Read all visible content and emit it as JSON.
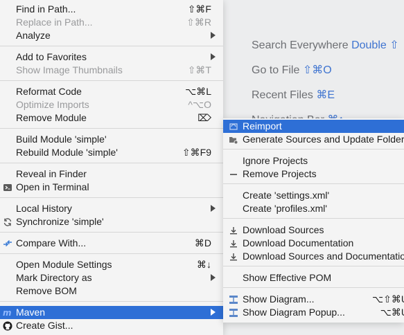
{
  "background_hints": [
    {
      "text": "Search Everywhere",
      "shortcut": "Double ⇧"
    },
    {
      "text": "Go to File",
      "shortcut": "⇧⌘O"
    },
    {
      "text": "Recent Files",
      "shortcut": "⌘E"
    },
    {
      "text": "Navigation Bar",
      "shortcut": "⌘↑"
    }
  ],
  "context_menu": {
    "find_in_path": {
      "label": "Find in Path...",
      "shortcut": "⇧⌘F"
    },
    "replace_in_path": {
      "label": "Replace in Path...",
      "shortcut": "⇧⌘R"
    },
    "analyze": {
      "label": "Analyze"
    },
    "add_to_favorites": {
      "label": "Add to Favorites"
    },
    "show_image_thumbnails": {
      "label": "Show Image Thumbnails",
      "shortcut": "⇧⌘T"
    },
    "reformat_code": {
      "label": "Reformat Code",
      "shortcut": "⌥⌘L"
    },
    "optimize_imports": {
      "label": "Optimize Imports",
      "shortcut": "^⌥O"
    },
    "remove_module": {
      "label": "Remove Module",
      "shortcut": "⌦"
    },
    "build_module": {
      "label": "Build Module 'simple'"
    },
    "rebuild_module": {
      "label": "Rebuild Module 'simple'",
      "shortcut": "⇧⌘F9"
    },
    "reveal_in_finder": {
      "label": "Reveal in Finder"
    },
    "open_in_terminal": {
      "label": "Open in Terminal"
    },
    "local_history": {
      "label": "Local History"
    },
    "synchronize": {
      "label": "Synchronize 'simple'"
    },
    "compare_with": {
      "label": "Compare With...",
      "shortcut": "⌘D"
    },
    "open_module_settings": {
      "label": "Open Module Settings",
      "shortcut": "⌘↓"
    },
    "mark_directory_as": {
      "label": "Mark Directory as"
    },
    "remove_bom": {
      "label": "Remove BOM"
    },
    "maven": {
      "label": "Maven"
    },
    "create_gist": {
      "label": "Create Gist..."
    }
  },
  "maven_submenu": {
    "reimport": {
      "label": "Reimport"
    },
    "generate_sources": {
      "label": "Generate Sources and Update Folders"
    },
    "ignore_projects": {
      "label": "Ignore Projects"
    },
    "remove_projects": {
      "label": "Remove Projects"
    },
    "create_settings_xml": {
      "label": "Create 'settings.xml'"
    },
    "create_profiles_xml": {
      "label": "Create 'profiles.xml'"
    },
    "download_sources": {
      "label": "Download Sources"
    },
    "download_documentation": {
      "label": "Download Documentation"
    },
    "download_sources_and_documentation": {
      "label": "Download Sources and Documentation"
    },
    "show_effective_pom": {
      "label": "Show Effective POM"
    },
    "show_diagram": {
      "label": "Show Diagram...",
      "shortcut": "⌥⇧⌘U"
    },
    "show_diagram_popup": {
      "label": "Show Diagram Popup...",
      "shortcut": "⌥⌘U"
    }
  },
  "colors": {
    "selection": "#2e6fd6",
    "menu_bg": "#f4f4f4",
    "disabled_text": "#999a9c",
    "hint_shortcut": "#3f74d0"
  }
}
